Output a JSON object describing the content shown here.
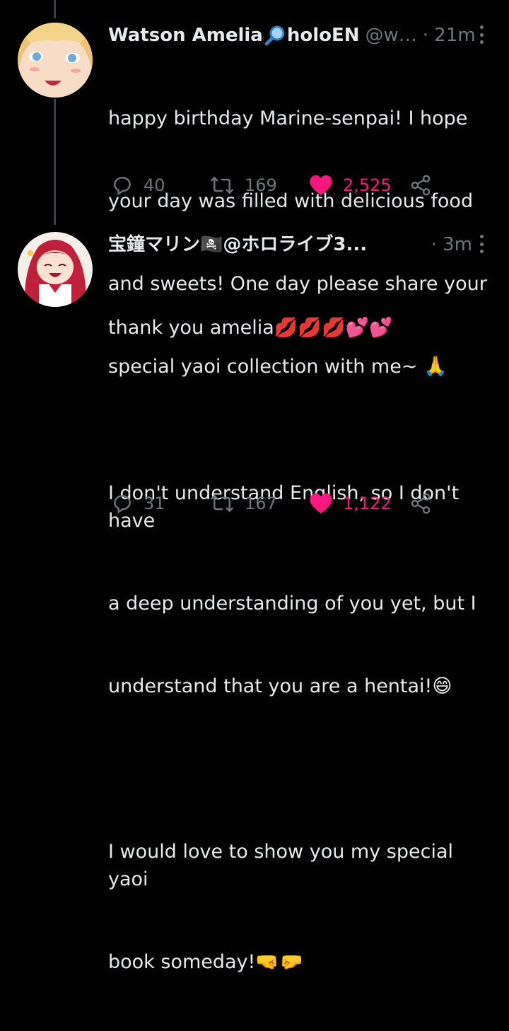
{
  "tweets": [
    {
      "author_name": "Watson Amelia",
      "name_suffix": "holoEN",
      "handle": "@w…",
      "time": "· 21m",
      "text_lines": [
        "happy birthday Marine-senpai! I hope",
        "your day was filled with delicious food",
        "and sweets! One day please share your",
        "special yaoi collection with me~ 🙏"
      ],
      "replies": "40",
      "retweets": "169",
      "likes": "2,525",
      "liked": true
    },
    {
      "author_name": "宝鐘マリン🏴‍☠️@ホロライブ3...",
      "handle": "",
      "time": "· 3m",
      "text_lines": [
        "thank you amelia💋💋💋💕💕",
        "",
        "I don't understand English, so I don't have",
        "a deep understanding of you yet, but I",
        "understand that you are a hentai!😄",
        "",
        "I would love to show you my special yaoi",
        "book someday!🤜🤛"
      ],
      "replies": "31",
      "retweets": "167",
      "likes": "1,122",
      "liked": true
    }
  ],
  "icons": {
    "reply": "reply-icon",
    "retweet": "retweet-icon",
    "like": "heart-icon",
    "share": "share-icon",
    "more": "more-icon",
    "magnifier": "magnifying-glass-icon"
  },
  "colors": {
    "background": "#000000",
    "text": "#e7e9ea",
    "muted": "#71767b",
    "like": "#f91880",
    "thread_line": "#3c4044"
  }
}
